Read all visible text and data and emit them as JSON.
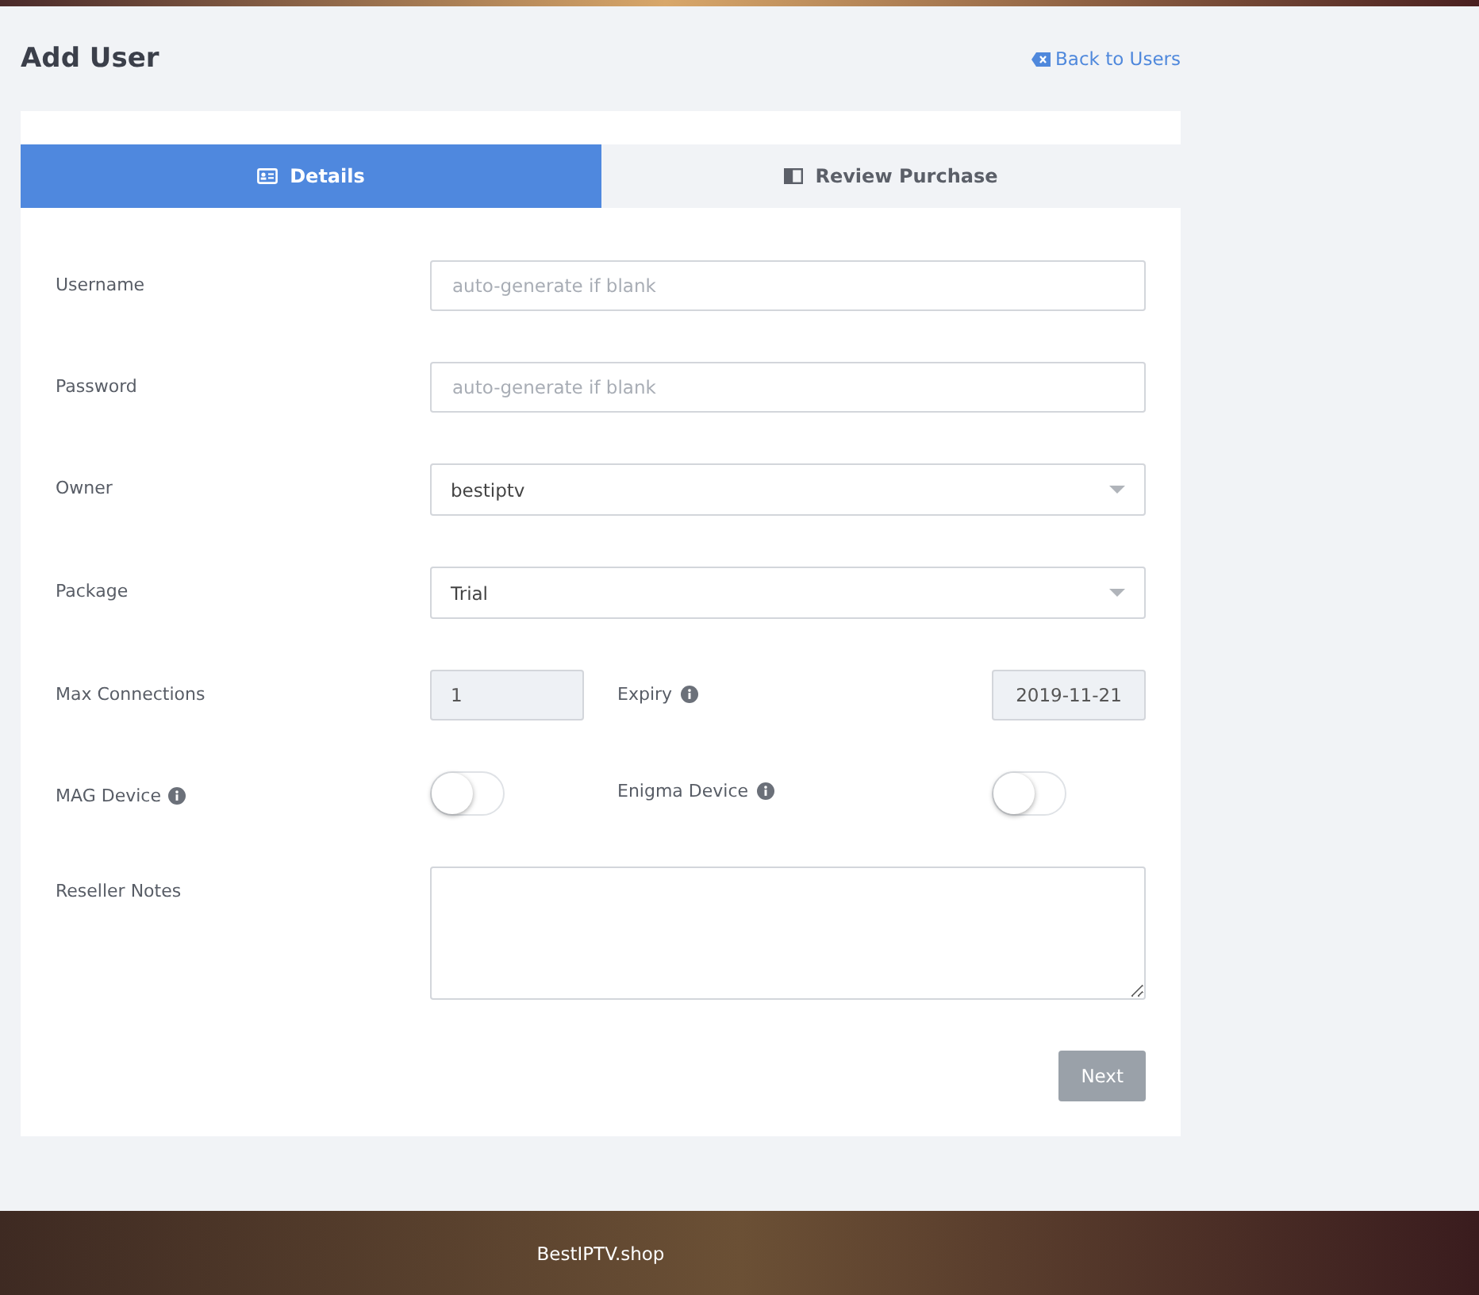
{
  "header": {
    "title": "Add User",
    "back_link": "Back to Users"
  },
  "tabs": [
    {
      "label": "Details",
      "selected": true,
      "kind": "id"
    },
    {
      "label": "Review Purchase",
      "selected": false,
      "kind": "book"
    }
  ],
  "fields": [
    {
      "kind": "text",
      "label": "Username",
      "placeholder": "auto-generate if blank"
    },
    {
      "kind": "text",
      "label": "Password",
      "placeholder": "auto-generate if blank"
    },
    {
      "kind": "select",
      "label": "Owner",
      "value": "bestiptv"
    },
    {
      "kind": "select",
      "label": "Package",
      "value": "Trial"
    },
    {
      "kind": "pair",
      "label": "Max Connections",
      "value": "1",
      "label2": "Expiry",
      "value2": "2019-11-21"
    },
    {
      "kind": "toggles",
      "label": "MAG Device",
      "on": false,
      "label2": "Enigma Device",
      "on2": false
    },
    {
      "kind": "textarea",
      "label": "Reseller Notes"
    }
  ],
  "next_button": {
    "label": "Next",
    "disabled": true
  },
  "footer": {
    "text": "BestIPTV.shop"
  }
}
